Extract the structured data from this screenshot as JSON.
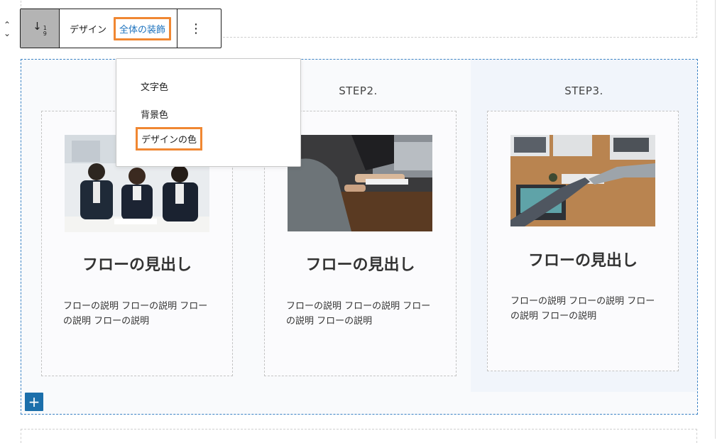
{
  "toolbar": {
    "design_label": "デザイン",
    "global_decoration_label": "全体の装飾",
    "more_icon": "vertical-ellipsis-icon",
    "block_type_icon": "sort-numeric-icon"
  },
  "dropdown": {
    "items": [
      {
        "label": "文字色"
      },
      {
        "label": "背景色"
      },
      {
        "label": "デザインの色"
      }
    ]
  },
  "flow": {
    "steps": [
      {
        "label": "",
        "title": "フローの見出し",
        "description": "フローの説明 フローの説明 フローの説明 フローの説明"
      },
      {
        "label": "STEP2.",
        "title": "フローの見出し",
        "description": "フローの説明 フローの説明 フローの説明 フローの説明"
      },
      {
        "label": "STEP3.",
        "title": "フローの見出し",
        "description": "フローの説明 フローの説明 フローの説明 フローの説明"
      }
    ],
    "add_icon": "plus-icon"
  },
  "colors": {
    "highlight_border": "#f08732",
    "accent_blue": "#1e73be",
    "add_button": "#1c6fab",
    "selection_outline": "#3b82c4"
  }
}
